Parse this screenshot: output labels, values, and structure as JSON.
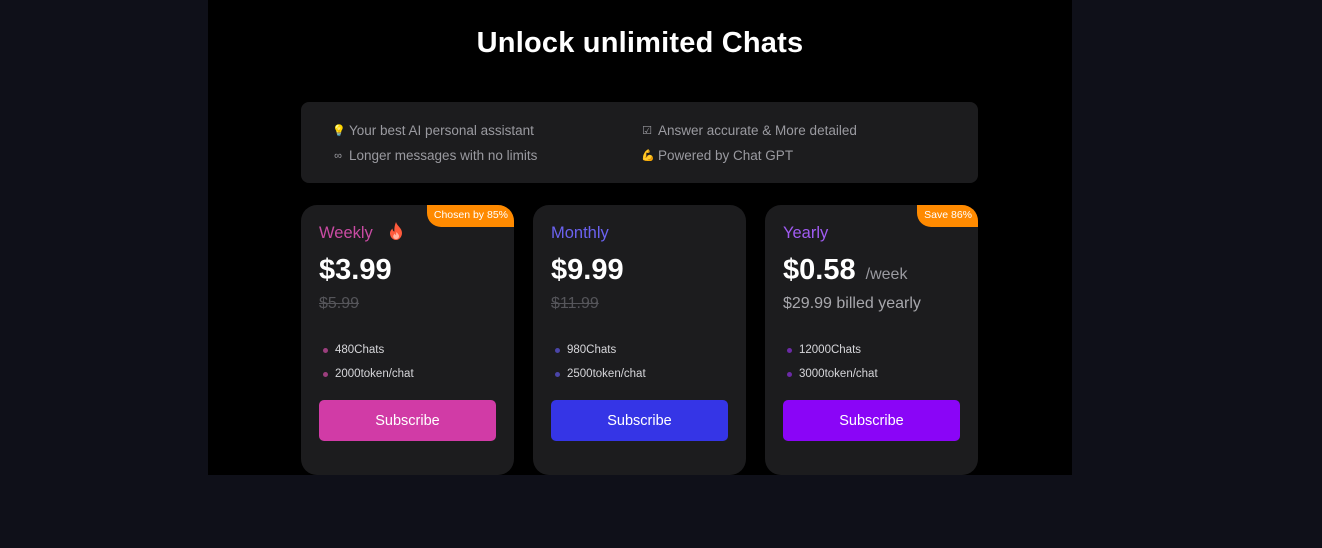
{
  "title": "Unlock unlimited Chats",
  "features": [
    {
      "icon": "bulb-icon",
      "glyph": "💡",
      "text": "Your best AI personal assistant"
    },
    {
      "icon": "check-box-icon",
      "glyph": "☑",
      "text": "Answer accurate & More detailed"
    },
    {
      "icon": "infinity-icon",
      "glyph": "∞",
      "text": "Longer messages with no limits"
    },
    {
      "icon": "flexed-arm-icon",
      "glyph": "💪",
      "text": "Powered by Chat GPT"
    }
  ],
  "plans": [
    {
      "name": "Weekly",
      "badge": "Chosen by 85%",
      "price": "$3.99",
      "old_price": "$5.99",
      "perks": [
        "480Chats",
        "2000token/chat"
      ],
      "button": "Subscribe",
      "accent": "#d13ba6"
    },
    {
      "name": "Monthly",
      "price": "$9.99",
      "old_price": "$11.99",
      "perks": [
        "980Chats",
        "2500token/chat"
      ],
      "button": "Subscribe",
      "accent": "#3535e6"
    },
    {
      "name": "Yearly",
      "badge": "Save 86%",
      "price": "$0.58",
      "price_unit": "/week",
      "billed": "$29.99 billed yearly",
      "perks": [
        "12000Chats",
        "3000token/chat"
      ],
      "button": "Subscribe",
      "accent": "#8a05f7"
    }
  ],
  "colors": {
    "background": "#0f1019",
    "modal": "#000000",
    "card": "#1c1c1e",
    "badge": "#ff8a00"
  }
}
